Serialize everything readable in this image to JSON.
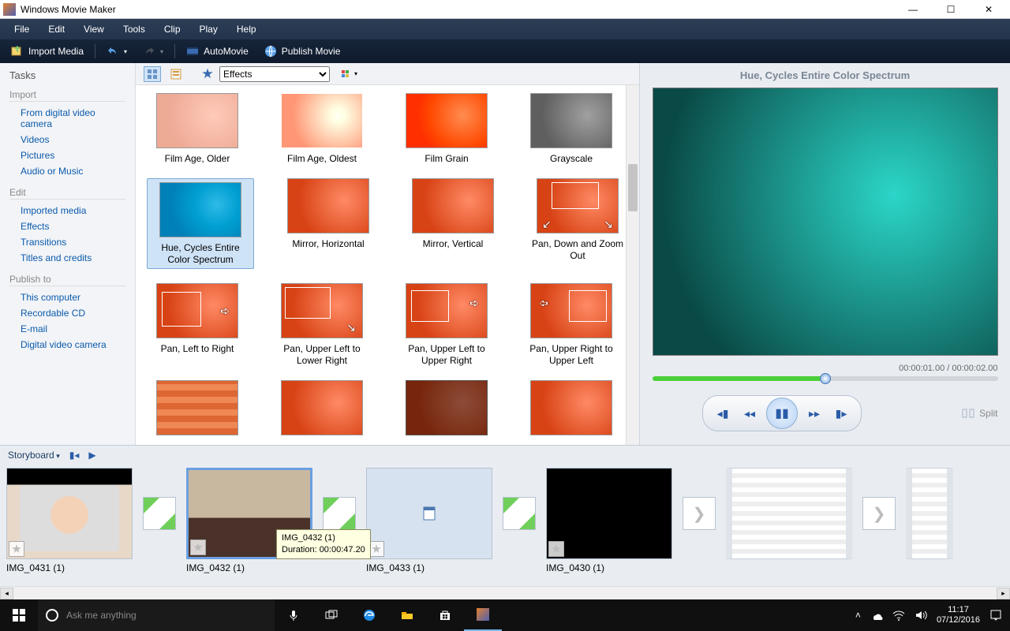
{
  "app": {
    "title": "Windows Movie Maker"
  },
  "menubar": [
    "File",
    "Edit",
    "View",
    "Tools",
    "Clip",
    "Play",
    "Help"
  ],
  "toolbar": {
    "import": "Import Media",
    "automovie": "AutoMovie",
    "publish": "Publish Movie"
  },
  "tasks": {
    "heading": "Tasks",
    "groups": [
      {
        "label": "Import",
        "items": [
          "From digital video camera",
          "Videos",
          "Pictures",
          "Audio or Music"
        ]
      },
      {
        "label": "Edit",
        "items": [
          "Imported media",
          "Effects",
          "Transitions",
          "Titles and credits"
        ]
      },
      {
        "label": "Publish to",
        "items": [
          "This computer",
          "Recordable CD",
          "E-mail",
          "Digital video camera"
        ]
      }
    ]
  },
  "center": {
    "dropdown": "Effects",
    "effects": [
      [
        "Film Age, Older",
        "Film Age, Oldest",
        "Film Grain",
        "Grayscale"
      ],
      [
        "Hue, Cycles Entire Color Spectrum",
        "Mirror, Horizontal",
        "Mirror, Vertical",
        "Pan, Down and Zoom Out"
      ],
      [
        "Pan, Left to Right",
        "Pan, Upper Left to Lower Right",
        "Pan, Upper Left to Upper Right",
        "Pan, Upper Right to Upper Left"
      ]
    ],
    "selected": "Hue, Cycles Entire Color Spectrum"
  },
  "preview": {
    "title": "Hue, Cycles Entire Color Spectrum",
    "time": "00:00:01.00 / 00:00:02.00",
    "split": "Split"
  },
  "storyboard": {
    "label": "Storyboard",
    "clips": [
      {
        "name": "IMG_0431 (1)"
      },
      {
        "name": "IMG_0432 (1)",
        "selected": true
      },
      {
        "name": "IMG_0433 (1)"
      },
      {
        "name": "IMG_0430 (1)"
      }
    ],
    "tooltip": {
      "line1": "IMG_0432 (1)",
      "line2": "Duration: 00:00:47.20"
    }
  },
  "taskbar": {
    "search_placeholder": "Ask me anything",
    "time": "11:17",
    "date": "07/12/2016"
  }
}
